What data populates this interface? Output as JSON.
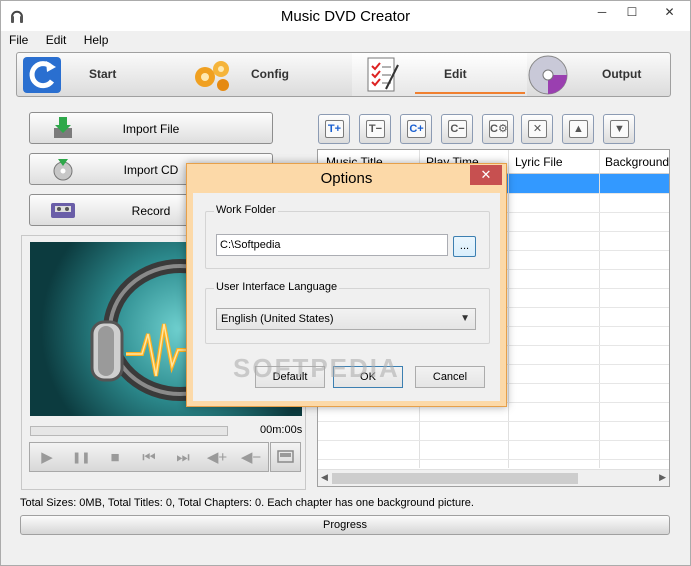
{
  "window": {
    "title": "Music DVD Creator",
    "minimize_glyph": "─",
    "maximize_glyph": "☐",
    "close_glyph": "✕"
  },
  "menu": [
    "File",
    "Edit",
    "Help"
  ],
  "nav_tabs": [
    {
      "label": "Start",
      "icon": "refresh-icon"
    },
    {
      "label": "Config",
      "icon": "gears-icon"
    },
    {
      "label": "Edit",
      "icon": "checklist-icon",
      "active": true
    },
    {
      "label": "Output",
      "icon": "disc-icon"
    }
  ],
  "left_buttons": {
    "import_file": "Import File",
    "import_cd": "Import CD",
    "record": "Record"
  },
  "player": {
    "time": "00m:00s",
    "controls": [
      "play-icon",
      "pause-icon",
      "stop-icon",
      "previous-icon",
      "next-icon",
      "volume-up-icon",
      "volume-down-icon"
    ],
    "control_glyphs": [
      "▶",
      "❚❚",
      "■",
      "⏮",
      "⏭",
      "◀+",
      "◀−"
    ]
  },
  "toolbar": {
    "buttons": [
      {
        "name": "add-title-button",
        "glyph": "T+"
      },
      {
        "name": "remove-title-button",
        "glyph": "T−"
      },
      {
        "name": "add-chapter-button",
        "glyph": "C+"
      },
      {
        "name": "remove-chapter-button",
        "glyph": "C−"
      },
      {
        "name": "chapter-settings-button",
        "glyph": "C⚙"
      },
      {
        "name": "delete-button",
        "glyph": "✕"
      },
      {
        "name": "move-up-button",
        "glyph": "▲"
      },
      {
        "name": "move-down-button",
        "glyph": "▼"
      }
    ]
  },
  "table": {
    "columns": [
      "Music Title",
      "Play Time",
      "Lyric File",
      "Background"
    ]
  },
  "status": "Total Sizes: 0MB, Total Titles: 0, Total Chapters: 0. Each chapter has one background picture.",
  "progress_label": "Progress",
  "dialog": {
    "title": "Options",
    "close_glyph": "✕",
    "work_folder_label": "Work Folder",
    "work_folder_value": "C:\\Softpedia",
    "browse_label": "...",
    "language_label": "User Interface Language",
    "language_value": "English (United States)",
    "default_button": "Default",
    "ok_button": "OK",
    "cancel_button": "Cancel"
  },
  "watermark": "SOFTPEDIA",
  "colors": {
    "accent_selected_row": "#3399ff",
    "dialog_frame": "#fcd9a8",
    "close_button": "#c75050",
    "tab_underline": "#f08030"
  }
}
